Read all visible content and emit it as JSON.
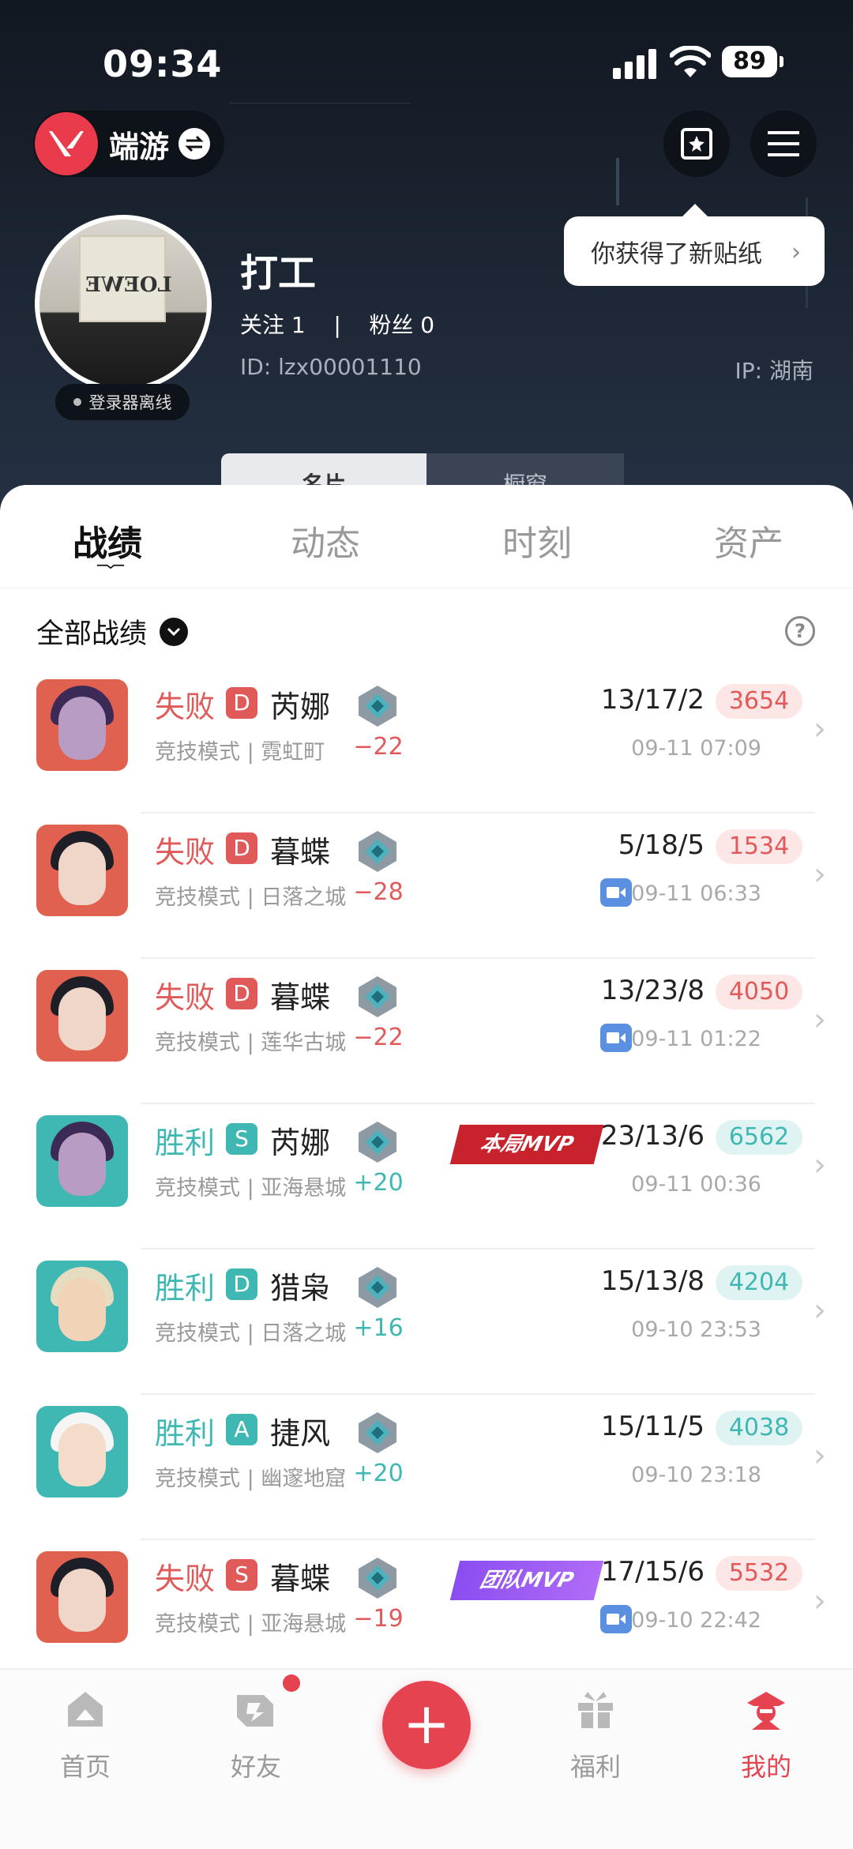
{
  "status_bar": {
    "time": "09:34",
    "battery": "89"
  },
  "header": {
    "app_name": "端游",
    "sticker_tip": "你获得了新贴纸",
    "online_status": "登录器离线",
    "avatar_text": "LOEWE",
    "nickname": "打工",
    "follow_text": "关注 1    |    粉丝 0",
    "uid": "ID: lzx00001110",
    "ip": "IP: 湖南",
    "card_tabs": [
      "名片",
      "橱窗"
    ]
  },
  "tabs": [
    "战绩",
    "动态",
    "时刻",
    "资产"
  ],
  "filter": {
    "label": "全部战绩"
  },
  "matches": [
    {
      "result": "失败",
      "outcome": "lose",
      "grade": "D",
      "agent": "芮娜",
      "mode": "竞技模式 | 霓虹町",
      "delta": "−22",
      "kda": "13/17/2",
      "score": "3654",
      "time": "09-11 07:09",
      "video": false,
      "mvp": ""
    },
    {
      "result": "失败",
      "outcome": "lose",
      "grade": "D",
      "agent": "暮蝶",
      "mode": "竞技模式 | 日落之城",
      "delta": "−28",
      "kda": "5/18/5",
      "score": "1534",
      "time": "09-11 06:33",
      "video": true,
      "mvp": ""
    },
    {
      "result": "失败",
      "outcome": "lose",
      "grade": "D",
      "agent": "暮蝶",
      "mode": "竞技模式 | 莲华古城",
      "delta": "−22",
      "kda": "13/23/8",
      "score": "4050",
      "time": "09-11 01:22",
      "video": true,
      "mvp": ""
    },
    {
      "result": "胜利",
      "outcome": "win",
      "grade": "S",
      "agent": "芮娜",
      "mode": "竞技模式 | 亚海悬城",
      "delta": "+20",
      "kda": "23/13/6",
      "score": "6562",
      "time": "09-11 00:36",
      "video": false,
      "mvp": "本局MVP"
    },
    {
      "result": "胜利",
      "outcome": "win",
      "grade": "D",
      "agent": "猎枭",
      "mode": "竞技模式 | 日落之城",
      "delta": "+16",
      "kda": "15/13/8",
      "score": "4204",
      "time": "09-10 23:53",
      "video": false,
      "mvp": ""
    },
    {
      "result": "胜利",
      "outcome": "win",
      "grade": "A",
      "agent": "捷风",
      "mode": "竞技模式 | 幽邃地窟",
      "delta": "+20",
      "kda": "15/11/5",
      "score": "4038",
      "time": "09-10 23:18",
      "video": false,
      "mvp": ""
    },
    {
      "result": "失败",
      "outcome": "lose",
      "grade": "S",
      "agent": "暮蝶",
      "mode": "竞技模式 | 亚海悬城",
      "delta": "−19",
      "kda": "17/15/6",
      "score": "5532",
      "time": "09-10 22:42",
      "video": true,
      "mvp": "团队MVP"
    }
  ],
  "bottom_nav": [
    {
      "label": "首页",
      "icon": "home-icon"
    },
    {
      "label": "好友",
      "icon": "friends-icon"
    },
    {
      "label": "福利",
      "icon": "gift-icon"
    },
    {
      "label": "我的",
      "icon": "profile-icon"
    }
  ],
  "colors": {
    "accent": "#e5434f",
    "win": "#3fb7b2",
    "lose": "#e05a5a"
  }
}
